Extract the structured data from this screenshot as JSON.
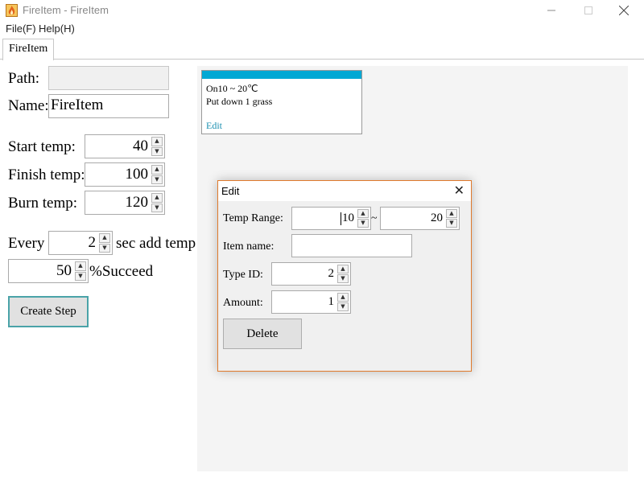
{
  "window": {
    "title": "FireItem - FireItem"
  },
  "menu": {
    "items": [
      "File(F)",
      "Help(H)"
    ]
  },
  "tabs": [
    {
      "label": "FireItem"
    }
  ],
  "form": {
    "path_label": "Path:",
    "path_value": "",
    "name_label": "Name:",
    "name_value": "FireItem",
    "start_label": "Start temp:",
    "start_value": "40",
    "finish_label": "Finish temp:",
    "finish_value": "100",
    "burn_label": "Burn temp:",
    "burn_value": "120",
    "every_label": "Every",
    "every_value": "2",
    "every_suffix": "sec add temp",
    "succeed_value": "50",
    "succeed_suffix": "%Succeed",
    "create_button": "Create Step"
  },
  "card": {
    "line1": "On10 ~ 20℃",
    "line2": "Put down 1 grass",
    "edit_link": "Edit",
    "header_color": "#00a8d4"
  },
  "dialog": {
    "title": "Edit",
    "temp_range_label": "Temp Range:",
    "temp_from": "10",
    "temp_sep": "~",
    "temp_to": "20",
    "item_name_label": "Item name:",
    "item_name_value": "",
    "type_id_label": "Type ID:",
    "type_id_value": "2",
    "amount_label": "Amount:",
    "amount_value": "1",
    "delete_button": "Delete",
    "border_color": "#e07a2c"
  }
}
